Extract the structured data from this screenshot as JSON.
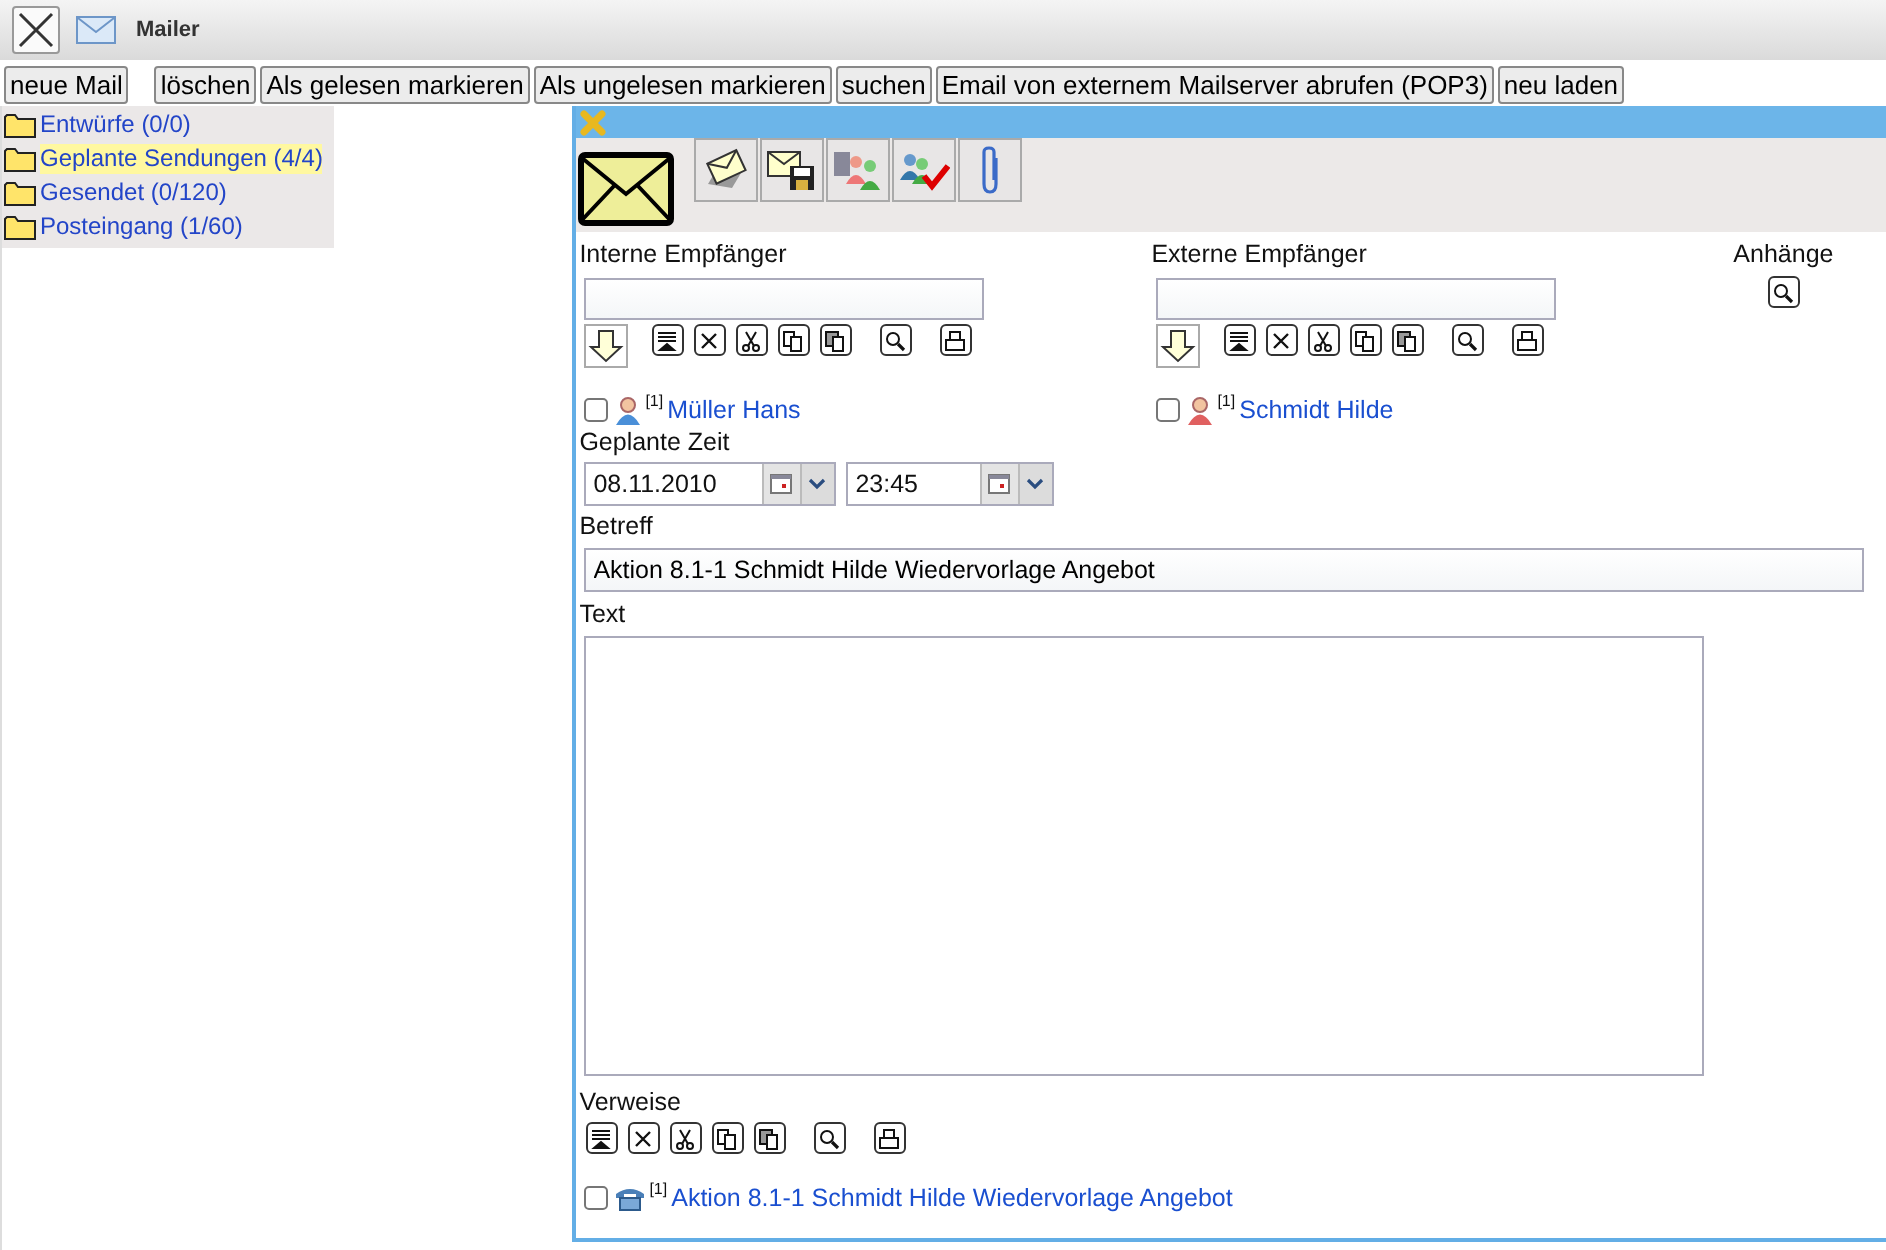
{
  "window": {
    "title": "Mailer"
  },
  "toolbar": [
    {
      "label": "neue Mail"
    },
    {
      "label": "löschen"
    },
    {
      "label": "Als gelesen markieren"
    },
    {
      "label": "Als ungelesen markieren"
    },
    {
      "label": "suchen"
    },
    {
      "label": "Email von externem Mailserver abrufen (POP3)"
    },
    {
      "label": "neu laden"
    }
  ],
  "folders": [
    {
      "label": "Entwürfe (0/0)",
      "selected": false
    },
    {
      "label": "Geplante Sendungen (4/4)",
      "selected": true
    },
    {
      "label": "Gesendet (0/120)",
      "selected": false
    },
    {
      "label": "Posteingang (1/60)",
      "selected": false
    }
  ],
  "editor": {
    "internal": {
      "label": "Interne Empfänger",
      "recipients": [
        {
          "kind": "male",
          "note": "[1]",
          "name": "Müller Hans",
          "checked": false
        }
      ]
    },
    "external": {
      "label": "Externe Empfänger",
      "recipients": [
        {
          "kind": "female",
          "note": "[1]",
          "name": "Schmidt Hilde",
          "checked": false
        }
      ]
    },
    "attachments": {
      "label": "Anhänge"
    },
    "schedule": {
      "label": "Geplante Zeit",
      "date": "08.11.2010",
      "time": "23:45"
    },
    "subject": {
      "label": "Betreff",
      "value": "Aktion 8.1-1 Schmidt Hilde Wiedervorlage Angebot"
    },
    "text": {
      "label": "Text"
    },
    "references": {
      "label": "Verweise",
      "items": [
        {
          "note": "[1]",
          "title": "Aktion 8.1-1 Schmidt Hilde Wiedervorlage Angebot",
          "checked": false
        }
      ]
    }
  }
}
